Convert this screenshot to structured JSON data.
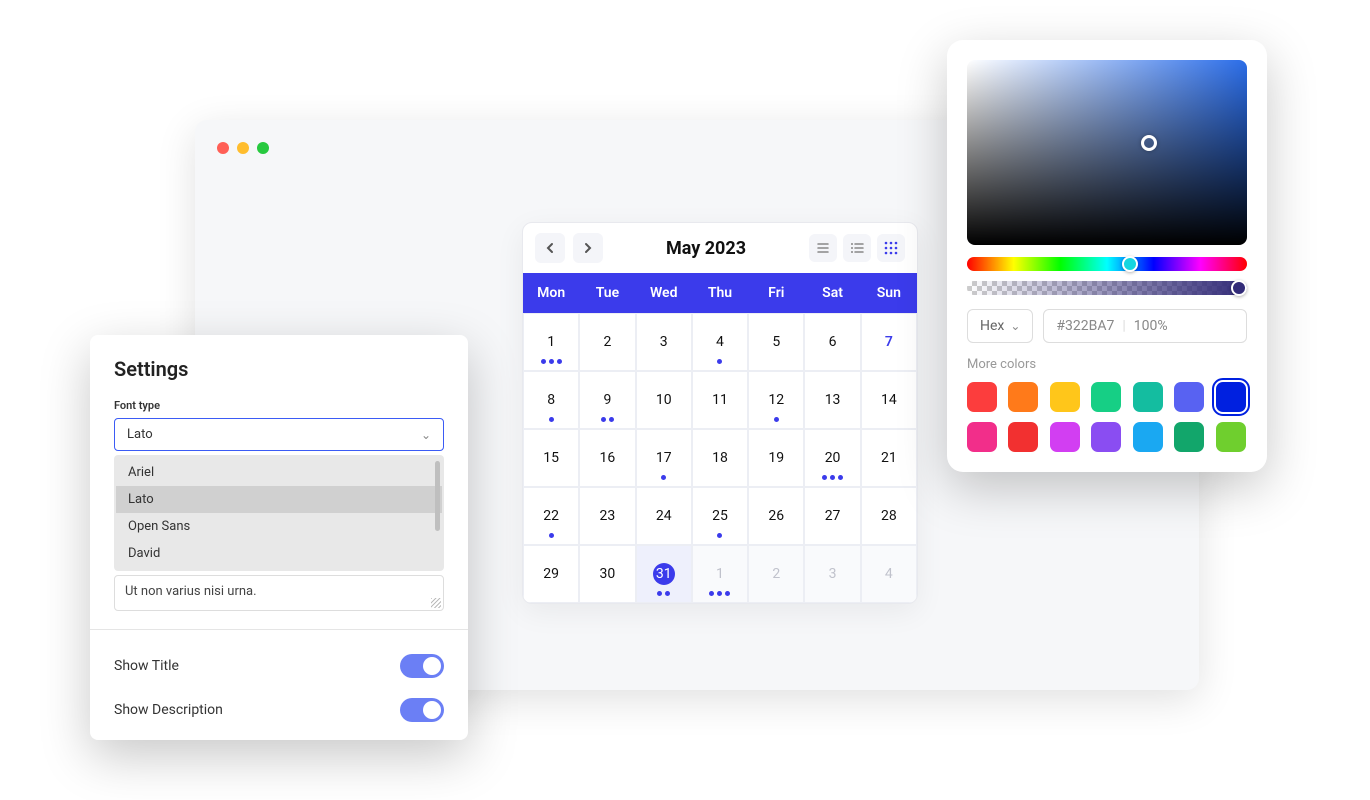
{
  "calendar": {
    "title": "May 2023",
    "weekdays": [
      "Mon",
      "Tue",
      "Wed",
      "Thu",
      "Fri",
      "Sat",
      "Sun"
    ],
    "cells": [
      {
        "n": "1",
        "dots": 3
      },
      {
        "n": "2",
        "dots": 0
      },
      {
        "n": "3",
        "dots": 0
      },
      {
        "n": "4",
        "dots": 1
      },
      {
        "n": "5",
        "dots": 0
      },
      {
        "n": "6",
        "dots": 0
      },
      {
        "n": "7",
        "dots": 0,
        "highlight": true
      },
      {
        "n": "8",
        "dots": 1
      },
      {
        "n": "9",
        "dots": 2
      },
      {
        "n": "10",
        "dots": 0
      },
      {
        "n": "11",
        "dots": 0
      },
      {
        "n": "12",
        "dots": 1
      },
      {
        "n": "13",
        "dots": 0
      },
      {
        "n": "14",
        "dots": 0
      },
      {
        "n": "15",
        "dots": 0
      },
      {
        "n": "16",
        "dots": 0
      },
      {
        "n": "17",
        "dots": 1
      },
      {
        "n": "18",
        "dots": 0
      },
      {
        "n": "19",
        "dots": 0
      },
      {
        "n": "20",
        "dots": 3
      },
      {
        "n": "21",
        "dots": 0
      },
      {
        "n": "22",
        "dots": 1
      },
      {
        "n": "23",
        "dots": 0
      },
      {
        "n": "24",
        "dots": 0
      },
      {
        "n": "25",
        "dots": 1
      },
      {
        "n": "26",
        "dots": 0
      },
      {
        "n": "27",
        "dots": 0
      },
      {
        "n": "28",
        "dots": 0
      },
      {
        "n": "29",
        "dots": 0
      },
      {
        "n": "30",
        "dots": 0
      },
      {
        "n": "31",
        "dots": 2,
        "sel": true
      },
      {
        "n": "1",
        "dots": 3,
        "muted": true
      },
      {
        "n": "2",
        "dots": 0,
        "muted": true
      },
      {
        "n": "3",
        "dots": 0,
        "muted": true
      },
      {
        "n": "4",
        "dots": 0,
        "muted": true
      }
    ]
  },
  "settings": {
    "title": "Settings",
    "font_label": "Font type",
    "font_value": "Lato",
    "font_options": [
      "Ariel",
      "Lato",
      "Open Sans",
      "David"
    ],
    "font_selected_index": 1,
    "textarea": "Ut non varius nisi urna.",
    "show_title_label": "Show Title",
    "show_title": true,
    "show_desc_label": "Show Description",
    "show_desc": true
  },
  "picker": {
    "format_label": "Hex",
    "hex_value": "#322BA7",
    "opacity": "100%",
    "more_label": "More colors",
    "swatches": [
      {
        "c": "#fc3d3d"
      },
      {
        "c": "#ff7a1a"
      },
      {
        "c": "#ffc61a"
      },
      {
        "c": "#16cf85"
      },
      {
        "c": "#14bda0"
      },
      {
        "c": "#5862f2"
      },
      {
        "c": "#0020e0",
        "sel": true
      },
      {
        "c": "#f22e8a"
      },
      {
        "c": "#f23030"
      },
      {
        "c": "#d23ef2"
      },
      {
        "c": "#8a4df2"
      },
      {
        "c": "#1aa8f2"
      },
      {
        "c": "#12a66b"
      },
      {
        "c": "#6fcf2e"
      }
    ]
  }
}
